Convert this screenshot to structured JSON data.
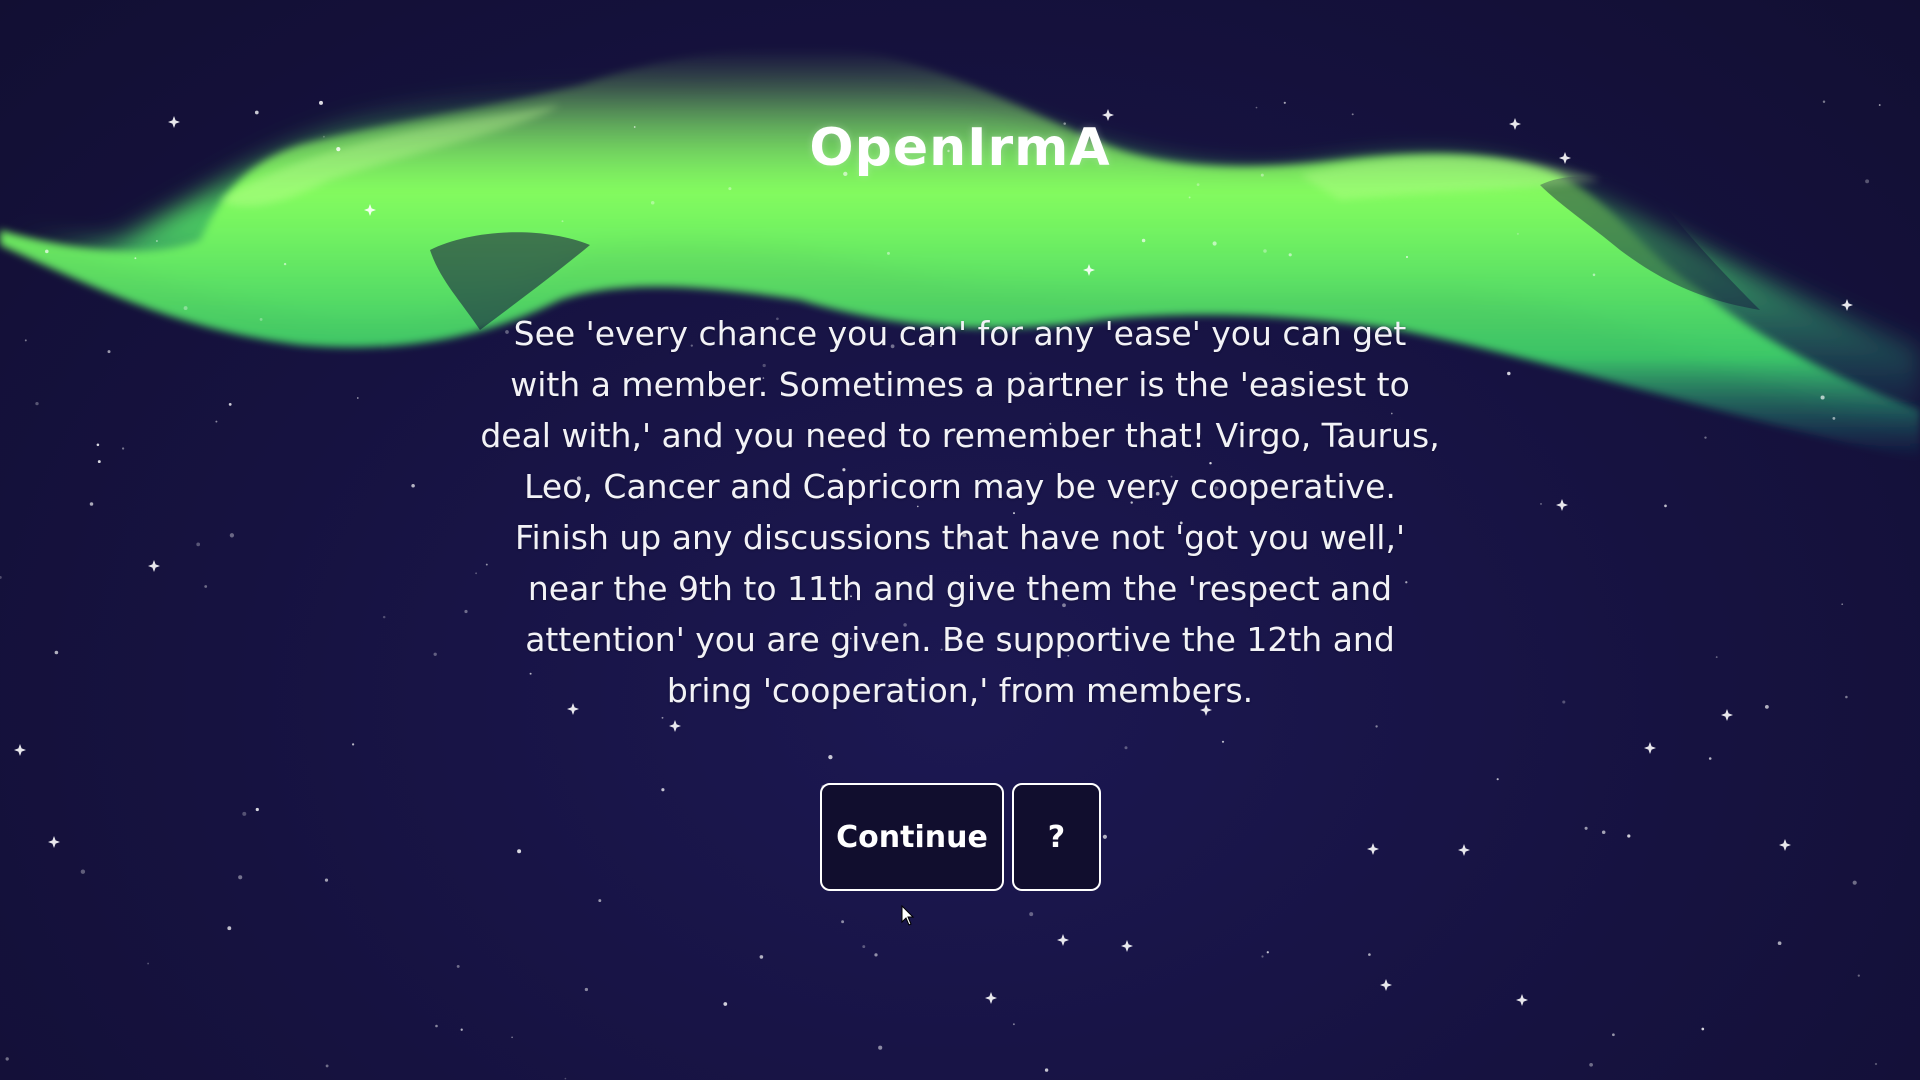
{
  "app": {
    "title": "OpenIrmA"
  },
  "message": {
    "text": "See 'every chance you can' for any 'ease' you can get with a member. Sometimes a partner is the 'easiest to deal with,' and you need to remember that! Virgo, Taurus, Leo, Cancer and Capricorn may be very cooperative. Finish up any discussions that have not 'got you well,' near the 9th to 11th and give them the 'respect and attention' you are given. Be supportive the 12th and bring 'cooperation,' from members."
  },
  "buttons": {
    "continue_label": "Continue",
    "help_label": "?"
  },
  "icons": {
    "cursor": "mouse-pointer-icon"
  },
  "colors": {
    "background": "#15123c",
    "aurora_bright": "#7dff5a",
    "aurora_mid": "#3ed66a",
    "aurora_teal": "#1f9e8a",
    "button_border": "#ffffff",
    "text": "#f4f4f8"
  }
}
